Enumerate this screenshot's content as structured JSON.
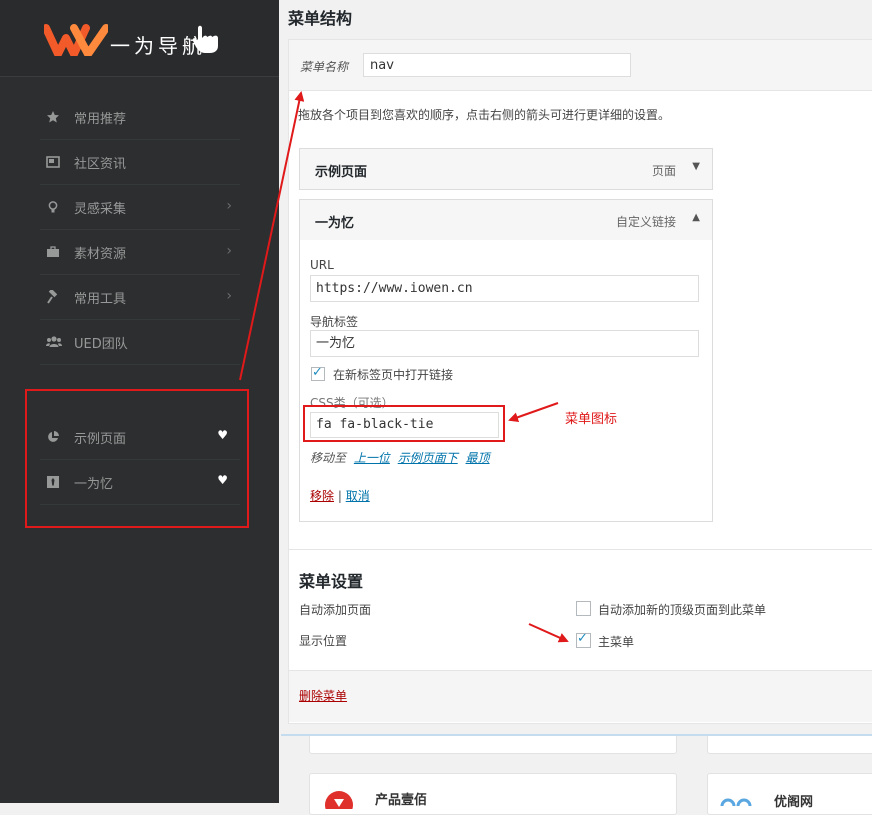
{
  "sidebar": {
    "logo_text": "一为导航",
    "items": [
      {
        "label": "常用推荐",
        "icon": "star-icon"
      },
      {
        "label": "社区资讯",
        "icon": "newspaper-icon"
      },
      {
        "label": "灵感采集",
        "icon": "lightbulb-icon"
      },
      {
        "label": "素材资源",
        "icon": "briefcase-icon"
      },
      {
        "label": "常用工具",
        "icon": "hammer-icon"
      },
      {
        "label": "UED团队",
        "icon": "users-icon"
      }
    ],
    "custom_items": [
      {
        "label": "示例页面",
        "icon": "pie-chart-icon"
      },
      {
        "label": "一为忆",
        "icon": "black-tie-icon"
      }
    ],
    "heart_glyph": "♥",
    "chevron_glyph": "›"
  },
  "panel": {
    "title": "菜单结构",
    "menu_name_label": "菜单名称",
    "menu_name_value": "nav",
    "instructions": "拖放各个项目到您喜欢的顺序，点击右侧的箭头可进行更详细的设置。",
    "item1": {
      "title": "示例页面",
      "type": "页面"
    },
    "item2": {
      "title": "一为忆",
      "type": "自定义链接",
      "url_label": "URL",
      "url_value": "https://www.iowen.cn",
      "nav_label": "导航标签",
      "nav_value": "一为忆",
      "new_tab_label": "在新标签页中打开链接",
      "css_label": "CSS类（可选）",
      "css_value": "fa fa-black-tie",
      "move_label": "移动至",
      "move_up": "上一位",
      "move_under": "示例页面下",
      "move_top": "最顶",
      "remove": "移除",
      "separator": "|",
      "cancel": "取消"
    },
    "settings": {
      "title": "菜单设置",
      "auto_add_label": "自动添加页面",
      "auto_add_option": "自动添加新的顶级页面到此菜单",
      "location_label": "显示位置",
      "location_option": "主菜单"
    },
    "delete_menu": "删除菜单"
  },
  "annotation": {
    "text": "菜单图标",
    "color": "#e0191a"
  },
  "background_cards": [
    {
      "title": "产品壹佰"
    },
    {
      "title": "优阁网"
    }
  ],
  "colors": {
    "accent": "#0073aa",
    "danger": "#a00",
    "annotation": "#e0191a",
    "sidebar": "#2c2e2f"
  }
}
